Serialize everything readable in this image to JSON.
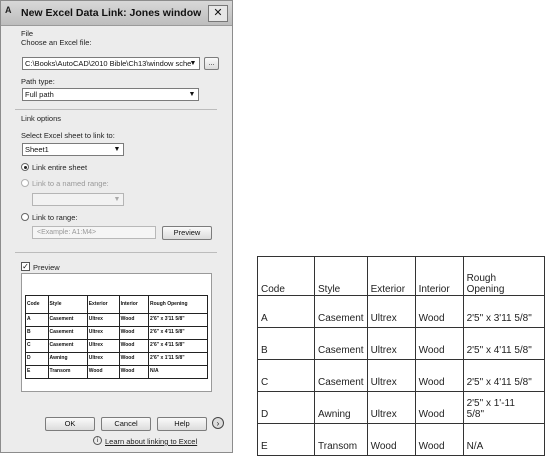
{
  "dialog": {
    "title": "New Excel Data Link: Jones window sche...",
    "app_icon": "A",
    "close_glyph": "✕",
    "file_section": "File",
    "choose_file_label": "Choose an Excel file:",
    "file_value": "C:\\Books\\AutoCAD\\2010 Bible\\Ch13\\window sche",
    "browse_label": "...",
    "path_type_label": "Path type:",
    "path_type_value": "Full path",
    "link_options_section": "Link options",
    "select_sheet_label": "Select Excel sheet to link to:",
    "sheet_value": "Sheet1",
    "radio_entire_sheet": "Link entire sheet",
    "radio_named_range": "Link to a named range:",
    "radio_range": "Link to range:",
    "range_placeholder": "<Example: A1:M4>",
    "preview_button": "Preview",
    "preview_check_label": "Preview",
    "ok_button": "OK",
    "cancel_button": "Cancel",
    "help_button": "Help",
    "more_glyph": "›",
    "learn_link": "Learn about linking to Excel",
    "help_icon_glyph": "i"
  },
  "preview_table": {
    "headers": [
      "Code",
      "Style",
      "Exterior",
      "Interior",
      "Rough Opening"
    ],
    "rows": [
      [
        "A",
        "Casement",
        "Ultrex",
        "Wood",
        "2'6\" x 3'11 5/8\""
      ],
      [
        "B",
        "Casement",
        "Ultrex",
        "Wood",
        "2'6\" x 4'11 5/8\""
      ],
      [
        "C",
        "Casement",
        "Ultrex",
        "Wood",
        "2'6\" x 4'11 5/8\""
      ],
      [
        "D",
        "Awning",
        "Ultrex",
        "Wood",
        "2'6\" x 1'11 5/8\""
      ],
      [
        "E",
        "Transom",
        "Wood",
        "Wood",
        "N/A"
      ]
    ]
  },
  "excel_table": {
    "headers": [
      "Code",
      "Style",
      "Exterior",
      "Interior",
      "Rough\nOpening"
    ],
    "rows": [
      [
        "A",
        "Casement",
        "Ultrex",
        "Wood",
        "2'5\" x 3'11 5/8\""
      ],
      [
        "B",
        "Casement",
        "Ultrex",
        "Wood",
        "2'5\" x 4'11 5/8\""
      ],
      [
        "C",
        "Casement",
        "Ultrex",
        "Wood",
        "2'5\" x 4'11 5/8\""
      ],
      [
        "D",
        "Awning",
        "Ultrex",
        "Wood",
        "2'5\" x 1'-11\n5/8\""
      ],
      [
        "E",
        "Transom",
        "Wood",
        "Wood",
        "N/A"
      ]
    ]
  }
}
